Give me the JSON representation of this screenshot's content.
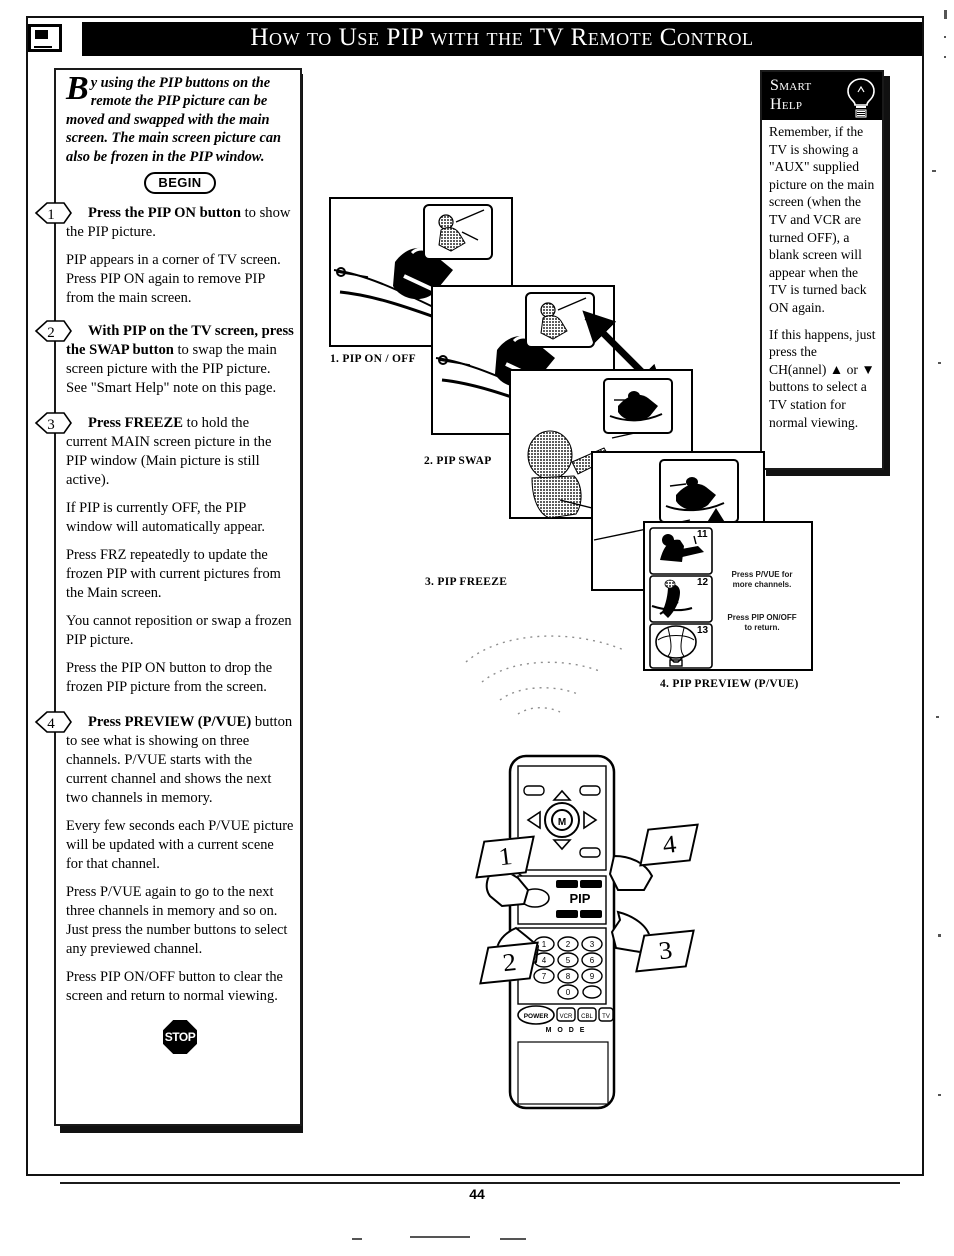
{
  "page": {
    "number": "44",
    "header_title": "How to Use PIP with the TV Remote Control",
    "header_icon": "tv-pip-icon"
  },
  "intro": {
    "dropcap": "B",
    "text": "y using the PIP buttons on the remote the  PIP picture can be moved and swapped with the main screen.  The main screen picture can also be frozen in the PIP window.",
    "begin_label": "BEGIN",
    "stop_label": "STOP"
  },
  "steps": [
    {
      "number": "1",
      "heading_bold": "Press the PIP ON button",
      "heading_rest": " to show the PIP picture.",
      "paragraphs": [
        "PIP appears in a corner of TV screen.  Press PIP ON again to remove PIP from the main screen."
      ]
    },
    {
      "number": "2",
      "heading_bold": "With PIP on the TV screen, press the SWAP button",
      "heading_rest": " to swap the main screen picture with the PIP picture. See \"Smart Help\" note on this page.",
      "paragraphs": []
    },
    {
      "number": "3",
      "heading_bold": "Press FREEZE",
      "heading_rest": " to hold the current MAIN screen picture in the PIP window (Main picture is still active).",
      "paragraphs": [
        "If PIP is currently OFF, the PIP window will automatically appear.",
        "Press FRZ repeatedly to update the  frozen PIP with current pictures from the Main screen.",
        "You cannot reposition or swap a frozen PIP picture.",
        "Press the PIP ON button to drop the frozen PIP picture from the screen."
      ]
    },
    {
      "number": "4",
      "heading_bold": "Press PREVIEW (P/VUE)",
      "heading_rest": " button to see what is showing on three channels. P/VUE starts with the current channel and shows the next two channels in memory.",
      "paragraphs": [
        "Every few seconds each P/VUE picture will be updated with a current scene for that channel.",
        "Press P/VUE again to go to the next three channels in memory and so on. Just press the number buttons to select any previewed channel.",
        "Press PIP ON/OFF button to clear the screen and return to normal viewing."
      ]
    }
  ],
  "smart_help": {
    "title_line1": "Smart",
    "title_line2": "Help",
    "icon": "lightbulb-icon",
    "paragraphs": [
      "Remember, if the TV is showing a \"AUX\" supplied picture on the main screen (when the TV and VCR are turned OFF), a blank screen will appear when the TV is turned back ON again.",
      "If this happens, just press the CH(annel) ▲ or ▼ buttons to select a TV station for normal viewing."
    ]
  },
  "figures": [
    {
      "id": "fig-pip-onoff",
      "label": "1.  PIP ON / OFF"
    },
    {
      "id": "fig-pip-swap",
      "label": "2. PIP SWAP"
    },
    {
      "id": "fig-pip-freeze",
      "label": "3. PIP FREEZE"
    },
    {
      "id": "fig-pip-preview",
      "label": "4.  PIP PREVIEW (P/VUE)"
    }
  ],
  "preview_screen": {
    "channels": [
      "11",
      "12",
      "13"
    ],
    "osd_line1": "Press P/VUE for\nmore channels.",
    "osd_line2": "Press PIP ON/OFF\nto return."
  },
  "callouts": [
    {
      "number": "1"
    },
    {
      "number": "2"
    },
    {
      "number": "3"
    },
    {
      "number": "4"
    }
  ],
  "remote": {
    "brand_pip_label": "PIP",
    "mode_label": "M O D E",
    "mode_buttons": [
      "POWER",
      "VCR",
      "CBL",
      "TV"
    ],
    "keypad": [
      "1",
      "2",
      "3",
      "4",
      "5",
      "6",
      "7",
      "8",
      "9",
      "0"
    ]
  }
}
